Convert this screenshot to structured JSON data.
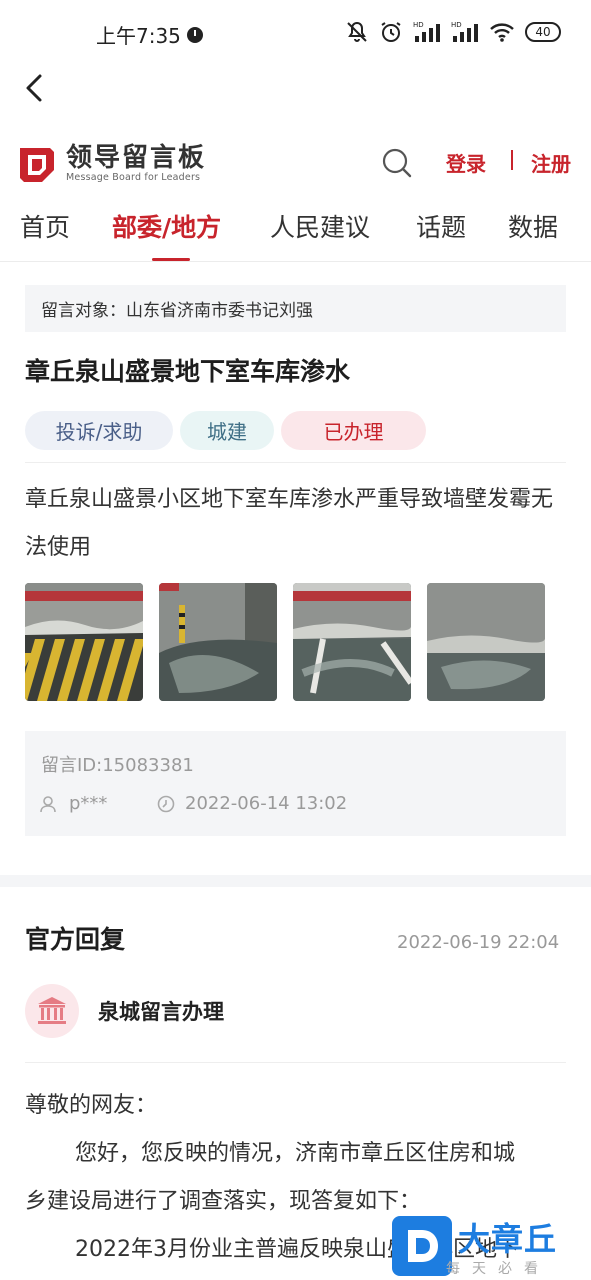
{
  "status_bar": {
    "time": "上午7:35",
    "battery": "40",
    "network": "HD"
  },
  "header": {
    "logo_cn": "领导留言板",
    "logo_en": "Message Board for Leaders",
    "login": "登录",
    "register": "注册"
  },
  "nav": {
    "items": [
      "首页",
      "部委/地方",
      "人民建议",
      "话题",
      "数据"
    ],
    "active_index": 1
  },
  "message": {
    "target_label": "留言对象：",
    "target": "山东省济南市委书记刘强",
    "title": "章丘泉山盛景地下室车库渗水",
    "tags": [
      "投诉/求助",
      "城建",
      "已办理"
    ],
    "content": "章丘泉山盛景小区地下室车库渗水严重导致墙壁发霉无法使用",
    "photo_count": 4,
    "id_text": "留言ID:15083381",
    "user": "p***",
    "time": "2022-06-14 13:02"
  },
  "reply": {
    "heading": "官方回复",
    "date": "2022-06-19 22:04",
    "department": "泉城留言办理",
    "greeting": "尊敬的网友：",
    "line1": "您好，您反映的情况，济南市章丘区住房和城",
    "line2": "乡建设局进行了调查落实，现答复如下：",
    "line3": "2022年3月份业主普遍反映泉山盛景小区地下"
  },
  "watermark": {
    "text": "大章丘",
    "sub": "每天必看"
  },
  "colors": {
    "accent": "#c8242c",
    "muted": "#9a9a9a",
    "panel": "#f4f5f7"
  }
}
